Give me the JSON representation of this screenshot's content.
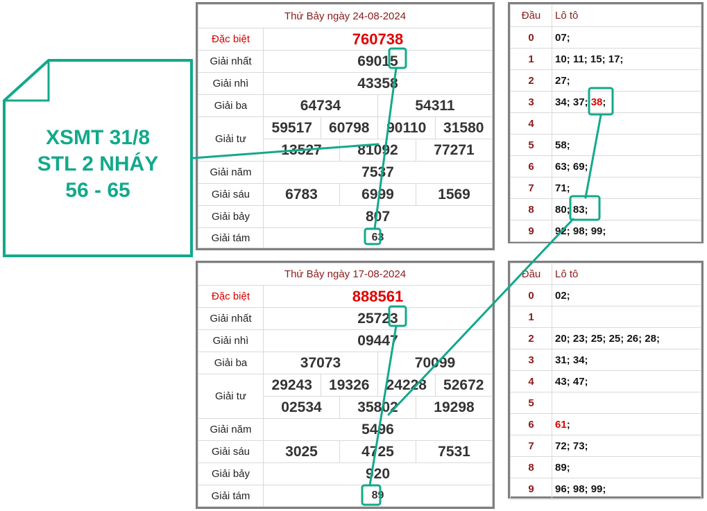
{
  "callout": {
    "line1": "XSMT 31/8",
    "line2": "STL 2 NHÁY",
    "line3": "56 - 65",
    "color": "#12a98a"
  },
  "result_top": {
    "date": "Thứ Bảy ngày 24-08-2024",
    "labels": {
      "db": "Đặc biệt",
      "g1": "Giải nhất",
      "g2": "Giải nhì",
      "g3": "Giải ba",
      "g4": "Giải tư",
      "g5": "Giải năm",
      "g6": "Giải sáu",
      "g7": "Giải bảy",
      "g8": "Giải tám"
    },
    "db": "760738",
    "g1": "69015",
    "g2": "43358",
    "g3": [
      "64734",
      "54311"
    ],
    "g4": [
      "59517",
      "60798",
      "90110",
      "31580",
      "13527",
      "81092",
      "77271"
    ],
    "g5": "7537",
    "g6": [
      "6783",
      "6999",
      "1569"
    ],
    "g7": "807",
    "g8": "63"
  },
  "result_bottom": {
    "date": "Thứ Bảy ngày 17-08-2024",
    "labels": {
      "db": "Đặc biệt",
      "g1": "Giải nhất",
      "g2": "Giải nhì",
      "g3": "Giải ba",
      "g4": "Giải tư",
      "g5": "Giải năm",
      "g6": "Giải sáu",
      "g7": "Giải bảy",
      "g8": "Giải tám"
    },
    "db": "888561",
    "g1": "25723",
    "g2": "09447",
    "g3": [
      "37073",
      "70099"
    ],
    "g4": [
      "29243",
      "19326",
      "24228",
      "52672",
      "02534",
      "35802",
      "19298"
    ],
    "g5": "5496",
    "g6": [
      "3025",
      "4725",
      "7531"
    ],
    "g7": "920",
    "g8": "89"
  },
  "loto_top": {
    "head_dau": "Đầu",
    "head_loto": "Lô tô",
    "rows": [
      {
        "dau": "0",
        "vals": [
          {
            "t": "07;"
          }
        ]
      },
      {
        "dau": "1",
        "vals": [
          {
            "t": "10;"
          },
          {
            "t": "11;"
          },
          {
            "t": "15;"
          },
          {
            "t": "17;"
          }
        ]
      },
      {
        "dau": "2",
        "vals": [
          {
            "t": "27;"
          }
        ]
      },
      {
        "dau": "3",
        "vals": [
          {
            "t": "34;"
          },
          {
            "t": "37;"
          },
          {
            "t": "38",
            "hot": true
          },
          {
            "t": ";"
          }
        ]
      },
      {
        "dau": "4",
        "vals": []
      },
      {
        "dau": "5",
        "vals": [
          {
            "t": "58;"
          }
        ]
      },
      {
        "dau": "6",
        "vals": [
          {
            "t": "63;"
          },
          {
            "t": "69;"
          }
        ]
      },
      {
        "dau": "7",
        "vals": [
          {
            "t": "71;"
          }
        ]
      },
      {
        "dau": "8",
        "vals": [
          {
            "t": "80;"
          },
          {
            "t": "83;"
          }
        ]
      },
      {
        "dau": "9",
        "vals": [
          {
            "t": "92;"
          },
          {
            "t": "98;"
          },
          {
            "t": "99;"
          }
        ]
      }
    ]
  },
  "loto_bottom": {
    "head_dau": "Đầu",
    "head_loto": "Lô tô",
    "rows": [
      {
        "dau": "0",
        "vals": [
          {
            "t": "02;"
          }
        ]
      },
      {
        "dau": "1",
        "vals": []
      },
      {
        "dau": "2",
        "vals": [
          {
            "t": "20;"
          },
          {
            "t": "23;"
          },
          {
            "t": "25;"
          },
          {
            "t": "25;"
          },
          {
            "t": "26;"
          },
          {
            "t": "28;"
          }
        ]
      },
      {
        "dau": "3",
        "vals": [
          {
            "t": "31;"
          },
          {
            "t": "34;"
          }
        ]
      },
      {
        "dau": "4",
        "vals": [
          {
            "t": "43;"
          },
          {
            "t": "47;"
          }
        ]
      },
      {
        "dau": "5",
        "vals": []
      },
      {
        "dau": "6",
        "vals": [
          {
            "t": "61",
            "hot": true
          },
          {
            "t": ";"
          }
        ]
      },
      {
        "dau": "7",
        "vals": [
          {
            "t": "72;"
          },
          {
            "t": "73;"
          }
        ]
      },
      {
        "dau": "8",
        "vals": [
          {
            "t": "89;"
          }
        ]
      },
      {
        "dau": "9",
        "vals": [
          {
            "t": "96;"
          },
          {
            "t": "98;"
          },
          {
            "t": "99;"
          }
        ]
      }
    ]
  }
}
